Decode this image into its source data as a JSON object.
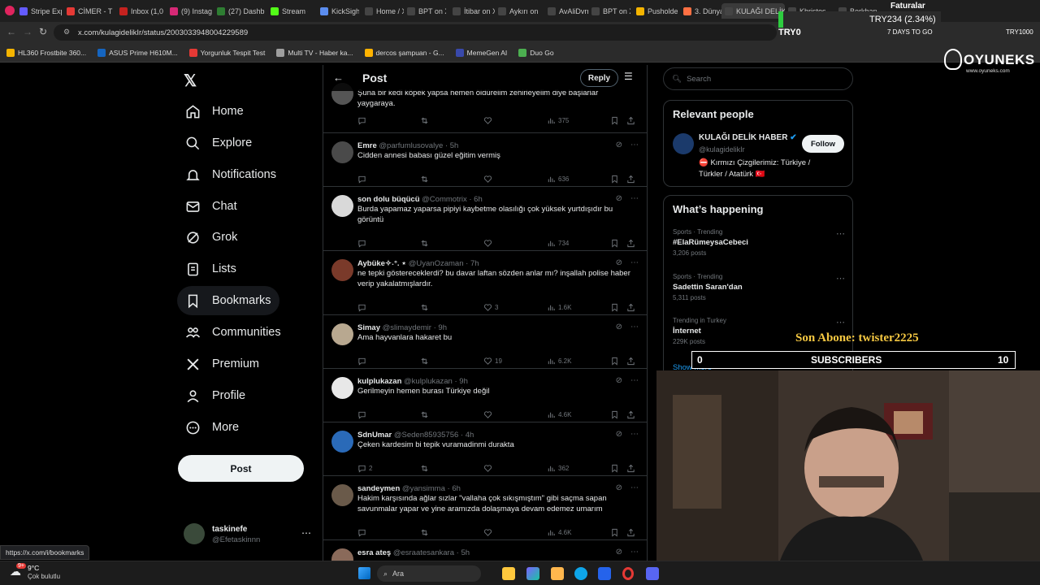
{
  "browser": {
    "tabs": [
      {
        "label": "Stripe Exp",
        "color": "#635bff"
      },
      {
        "label": "CİMER - T",
        "color": "#e53935"
      },
      {
        "label": "Inbox (1,0",
        "color": "#c5221f"
      },
      {
        "label": "(9) Instagr",
        "color": "#d62976"
      },
      {
        "label": "(27) Dashb",
        "color": "#2e7d32"
      },
      {
        "label": "Stream - K",
        "color": "#53fc18"
      },
      {
        "label": "KickSight",
        "color": "#5b8def"
      },
      {
        "label": "Home / X",
        "color": "#444"
      },
      {
        "label": "BPT on X:",
        "color": "#444"
      },
      {
        "label": "İtibar on X",
        "color": "#444"
      },
      {
        "label": "Aykırı on",
        "color": "#444"
      },
      {
        "label": "AvAliDvrn",
        "color": "#444"
      },
      {
        "label": "BPT on X:",
        "color": "#444"
      },
      {
        "label": "Pusholder",
        "color": "#f4b400"
      },
      {
        "label": "3. Dünya",
        "color": "#ff7043"
      },
      {
        "label": "KULAĞI DELİK H",
        "color": "#444"
      },
      {
        "label": "Khristos",
        "color": "#444"
      },
      {
        "label": "Berkhan",
        "color": "#444"
      }
    ],
    "url": "x.com/kulagidelikIr/status/2003033948004229589",
    "bookmarks": [
      "HL360 Frostbite 360...",
      "ASUS Prime H610M...",
      "Yorgunluk Tespit Test",
      "Multi TV - Haber ka...",
      "dercos şampuan - G...",
      "MemeGen AI",
      "Duo Go"
    ],
    "ticker": {
      "symbol": "TRY234",
      "change": "(2.34%)",
      "line2": "TRY0",
      "days": "7 DAYS TO GO",
      "faturalar": "Faturalar",
      "try_right": "TRY1000"
    },
    "status_url": "https://x.com/i/bookmarks"
  },
  "nav": {
    "items": [
      "Home",
      "Explore",
      "Notifications",
      "Chat",
      "Grok",
      "Lists",
      "Bookmarks",
      "Communities",
      "Premium",
      "Profile",
      "More"
    ],
    "post_label": "Post",
    "account": {
      "name": "taskinefe",
      "handle": "@Efetaskinnn"
    }
  },
  "feed": {
    "title": "Post",
    "reply_button": "Reply",
    "partial_text": "Şuna bir kedi köpek yapsa hemen öldürelim zehirleyelim diye başlarlar yaygaraya.",
    "partial_stats": {
      "replies": "",
      "likes": "",
      "views": "375"
    },
    "replies": [
      {
        "name": "Emre",
        "handle": "@parfumlusovalye",
        "time": "5h",
        "text": "Cidden annesi babası güzel eğitim vermiş",
        "replies": "",
        "likes": "",
        "views": "636",
        "avatar": "#4a4a4a"
      },
      {
        "name": "son dolu büqücü",
        "handle": "@Commotrix",
        "time": "6h",
        "text": "Burda yapamaz yaparsa pipiyi kaybetme olasılığı çok yüksek yurtdışıdır bu görüntü",
        "replies": "",
        "likes": "",
        "views": "734",
        "avatar": "#d9d9d9"
      },
      {
        "name": "Aybüke✧˖°. ⋆",
        "handle": "@UyanOzaman",
        "time": "7h",
        "text": "ne tepki göstereceklerdi? bu davar laftan sözden anlar mı? inşallah polise haber verip yakalatmışlardır.",
        "replies": "",
        "likes": "3",
        "views": "1.6K",
        "avatar": "#7a3a2a"
      },
      {
        "name": "Simay",
        "handle": "@slimaydemir",
        "time": "9h",
        "text": "Ama hayvanlara hakaret bu",
        "replies": "",
        "likes": "19",
        "views": "6.2K",
        "avatar": "#b8a890"
      },
      {
        "name": "kulplukazan",
        "handle": "@kulplukazan",
        "time": "9h",
        "text": "Gerilmeyin hemen burası Türkiye değil",
        "replies": "",
        "likes": "",
        "views": "4.6K",
        "avatar": "#e8e8e8"
      },
      {
        "name": "SdnUmar",
        "handle": "@Seden85935756",
        "time": "4h",
        "text": "Çeken kardesim bi tepik vuramadinmi durakta",
        "replies": "2",
        "likes": "",
        "views": "362",
        "avatar": "#2a6ab8"
      },
      {
        "name": "sandeymen",
        "handle": "@yansimma",
        "time": "6h",
        "text": "Hakim karşısında ağlar sızlar \"vallaha çok sıkışmıştım\" gibi saçma sapan savunmalar yapar ve yine aramızda dolaşmaya devam edemez umarım",
        "replies": "",
        "likes": "",
        "views": "4.6K",
        "avatar": "#6a5a4a"
      },
      {
        "name": "esra ateş",
        "handle": "@esraatesankara",
        "time": "5h",
        "text": "",
        "replies": "",
        "likes": "",
        "views": "",
        "avatar": "#8a6a5a"
      }
    ]
  },
  "sidebar": {
    "search_placeholder": "Search",
    "relevant_title": "Relevant people",
    "person": {
      "name": "KULAĞI DELİK HABER",
      "handle": "@kulagidelikIr",
      "bio": "⛔ Kırmızı Çizgilerimiz: Türkiye / Türkler / Atatürk 🇹🇷",
      "follow": "Follow"
    },
    "happening_title": "What’s happening",
    "trends": [
      {
        "meta": "Sports · Trending",
        "title": "#ElaRümeysaCebeci",
        "posts": "3,206 posts"
      },
      {
        "meta": "Sports · Trending",
        "title": "Sadettin Saran'dan",
        "posts": "5,311 posts"
      },
      {
        "meta": "Trending in Turkey",
        "title": "İnternet",
        "posts": "229K posts"
      }
    ],
    "show_more": "Show more"
  },
  "stream": {
    "logo": "OYUNEKS",
    "logo_sub": "www.oyuneks.com",
    "last_sub": "Son Abone: twister2225",
    "sub_left": "0",
    "sub_label": "SUBSCRIBERS",
    "sub_right": "10"
  },
  "taskbar": {
    "weather_temp": "9°C",
    "weather_desc": "Çok bulutlu",
    "badge": "9+",
    "search": "Ara"
  }
}
